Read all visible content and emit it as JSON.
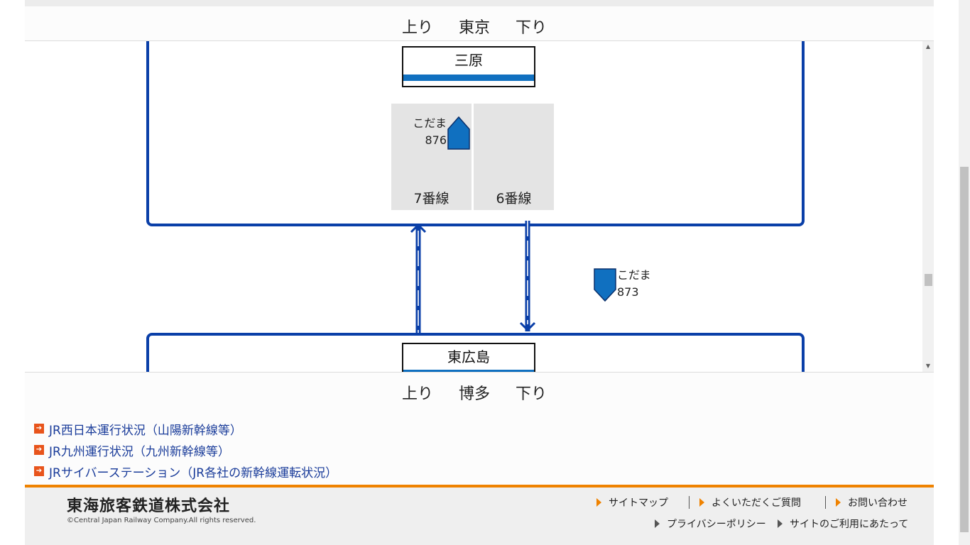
{
  "top_bar": {
    "up": "上り",
    "terminal": "東京",
    "down": "下り"
  },
  "bottom_bar": {
    "up": "上り",
    "terminal": "博多",
    "down": "下り"
  },
  "stations": [
    {
      "name": "三原",
      "tracks": [
        {
          "label": "7番線",
          "train": {
            "type": "こだま",
            "number": "876"
          }
        },
        {
          "label": "6番線"
        }
      ]
    },
    {
      "name": "東広島"
    }
  ],
  "between_trains": [
    {
      "type": "こだま",
      "number": "873"
    }
  ],
  "links": [
    {
      "label": "JR西日本運行状況（山陽新幹線等）"
    },
    {
      "label": "JR九州運行状況（九州新幹線等）"
    },
    {
      "label": "JRサイバーステーション（JR各社の新幹線運転状況）"
    }
  ],
  "footer": {
    "company": "東海旅客鉄道株式会社",
    "copyright": "©Central Japan Railway Company.All rights reserved.",
    "nav1": [
      "サイトマップ",
      "よくいただくご質問",
      "お問い合わせ"
    ],
    "nav2": [
      "プライバシーポリシー",
      "サイトのご利用にあたって"
    ]
  },
  "icons": {
    "link_arrow": "arrow-right-icon",
    "train": "train-icon",
    "triangle": "triangle-right-icon"
  },
  "colors": {
    "line_blue": "#0a3fa8",
    "train_blue": "#1070c0",
    "accent_orange": "#ef8200",
    "link_icon": "#e8541b"
  }
}
